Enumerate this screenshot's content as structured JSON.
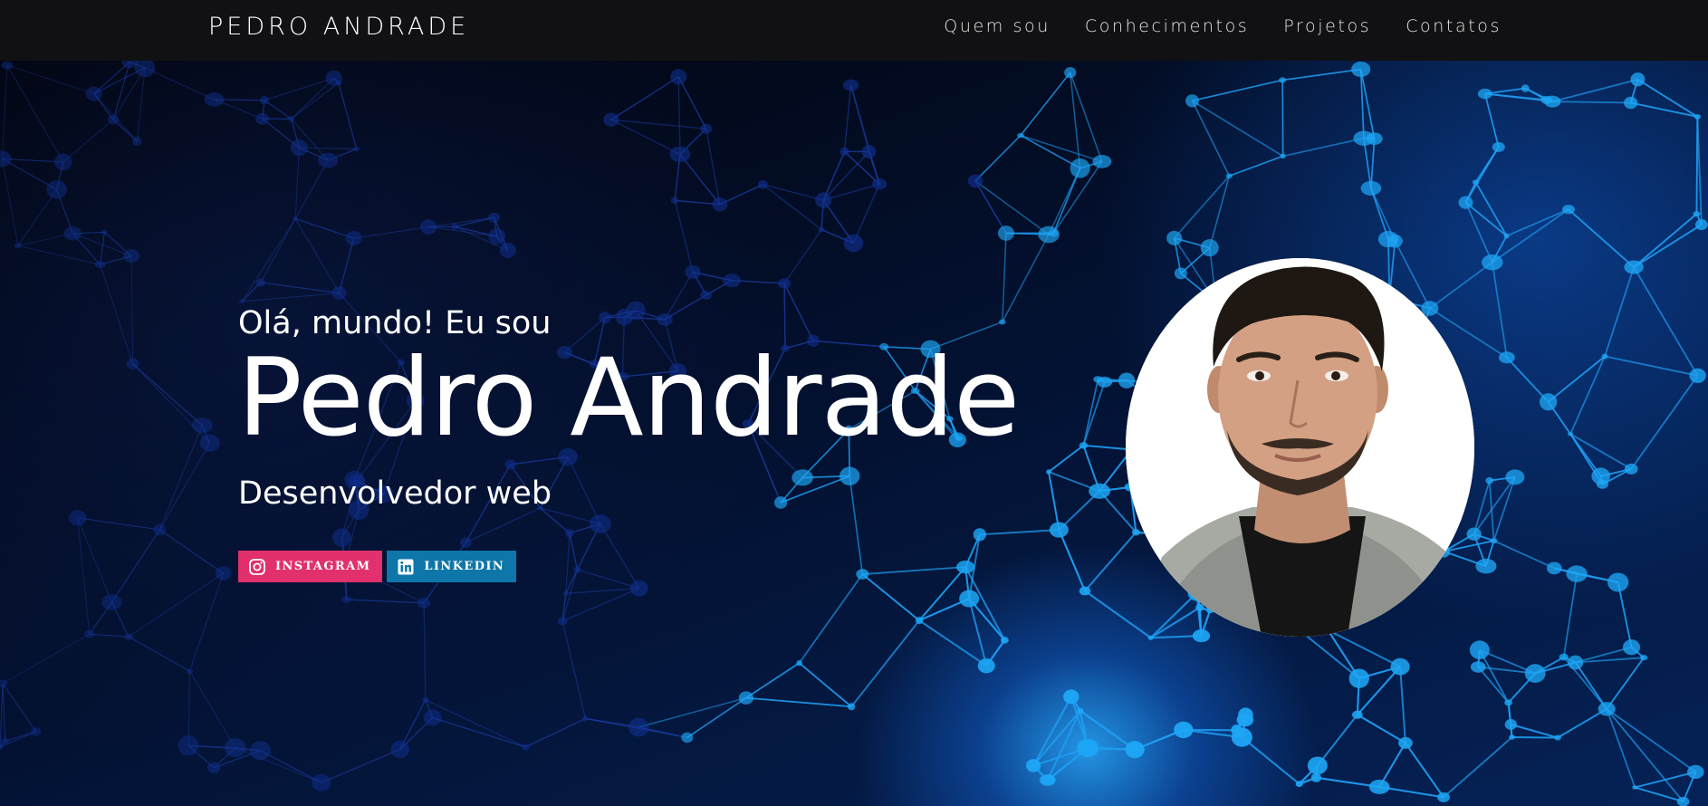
{
  "nav": {
    "brand": "PEDRO ANDRADE",
    "links": [
      {
        "label": "Quem sou"
      },
      {
        "label": "Conhecimentos"
      },
      {
        "label": "Projetos"
      },
      {
        "label": "Contatos"
      }
    ]
  },
  "hero": {
    "greeting": "Olá, mundo! Eu sou",
    "name": "Pedro Andrade",
    "role": "Desenvolvedor web",
    "social": [
      {
        "label": "INSTAGRAM",
        "icon": "instagram-icon",
        "color": "#e1306c"
      },
      {
        "label": "LINKEDIN",
        "icon": "linkedin-icon",
        "color": "#0e76a8"
      }
    ]
  },
  "colors": {
    "navbar_bg": "#111113",
    "hero_bg": "#04081a",
    "network_line": "#1a8fe8",
    "text": "#ffffff"
  }
}
